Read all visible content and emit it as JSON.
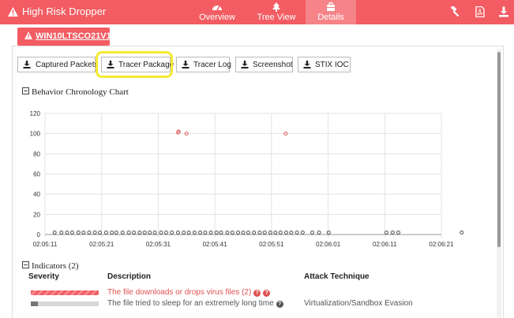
{
  "app": {
    "title": "High Risk Dropper",
    "nav": [
      {
        "label": "Overview",
        "icon": "dashboard-icon"
      },
      {
        "label": "Tree View",
        "icon": "tree-icon"
      },
      {
        "label": "Details",
        "icon": "suitcase-icon",
        "active": true
      }
    ],
    "toolbar_icons": [
      "hammer-icon",
      "pdf-icon",
      "download-icon"
    ],
    "accent": "#f25c62"
  },
  "host_tab": {
    "label": "WIN10LTSCO21V1",
    "icon": "warning-icon"
  },
  "actions": [
    {
      "label": "Captured Packets"
    },
    {
      "label": "Tracer Package",
      "highlighted": true
    },
    {
      "label": "Tracer Log"
    },
    {
      "label": "Screenshot"
    },
    {
      "label": "STIX IOC"
    }
  ],
  "behavior_section": {
    "title": "Behavior Chronology Chart"
  },
  "chart_data": {
    "type": "scatter",
    "title": "",
    "xlabel": "",
    "ylabel": "",
    "ylim": [
      0,
      120
    ],
    "yticks": [
      0,
      20,
      40,
      60,
      80,
      100,
      120
    ],
    "xticks": [
      "02:05:11",
      "02:05:21",
      "02:05:31",
      "02:05:41",
      "02:05:51",
      "02:06:01",
      "02:06:11",
      "02:06:21"
    ],
    "grid": true,
    "series": [
      {
        "color": "#e06060",
        "x": [
          23.5,
          23.6,
          25.0,
          42.5
        ],
        "y": [
          101,
          102,
          100,
          100
        ]
      },
      {
        "color": "#555555",
        "x": [
          1.7,
          2.9,
          3.9,
          4.8,
          5.9,
          6.8,
          7.8,
          8.8,
          9.7,
          10.8,
          11.8,
          12.6,
          13.7,
          14.8,
          15.7,
          16.7,
          17.6,
          18.5,
          19.4,
          20.5,
          21.4,
          22.4,
          23.5,
          24.5,
          25.4,
          26.4,
          27.4,
          28.3,
          29.3,
          30.3,
          31.1,
          32.2,
          33.1,
          34.1,
          35.0,
          35.9,
          36.9,
          37.9,
          38.8,
          39.8,
          40.7,
          41.6,
          42.6,
          43.5,
          44.5,
          45.5,
          47.2,
          48.4,
          50.1,
          60.3,
          61.4,
          62.4,
          73.6,
          84.7
        ],
        "y": [
          2,
          2,
          2,
          2,
          2,
          2,
          2,
          2,
          2,
          2,
          2,
          2,
          2,
          2,
          2,
          2,
          2,
          2,
          2,
          2,
          2,
          2,
          2,
          2,
          2,
          2,
          2,
          2,
          2,
          2,
          2,
          2,
          2,
          2,
          2,
          2,
          2,
          2,
          2,
          2,
          2,
          2,
          2,
          2,
          2,
          2,
          2,
          2,
          2,
          2,
          2,
          2,
          2,
          2
        ]
      }
    ]
  },
  "indicators": {
    "title": "Indicators (2)",
    "headers": {
      "severity": "Severity",
      "description": "Description",
      "technique": "Attack Technique"
    },
    "rows": [
      {
        "severity_level": 1.0,
        "severity_color": "#f25c62",
        "description": "The file downloads or drops virus files (2)",
        "description_color": "#e0504f",
        "technique": "",
        "help_color": "#e0504f"
      },
      {
        "severity_level": 0.1,
        "severity_color": "#777777",
        "description": "The file tried to sleep for an extremely long time",
        "description_color": "#555555",
        "technique": "Virtualization/Sandbox Evasion",
        "help_color": "#555555"
      }
    ]
  }
}
